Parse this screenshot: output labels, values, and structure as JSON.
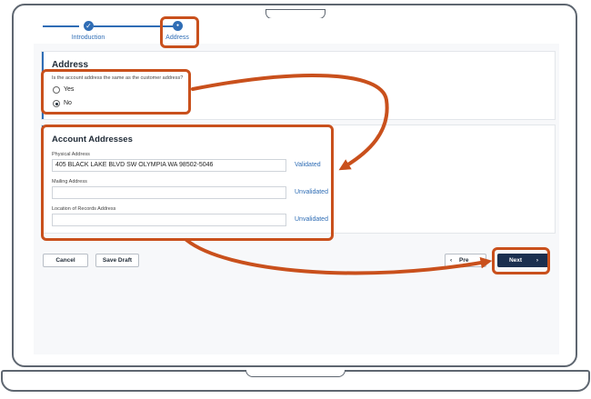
{
  "stepper": {
    "steps": [
      {
        "label": "Introduction",
        "icon": "check-icon",
        "glyph": "✓"
      },
      {
        "label": "Address",
        "icon": "dot-icon",
        "glyph": "●"
      }
    ]
  },
  "address_panel": {
    "title": "Address",
    "question": "Is the account address the same as the customer address?",
    "options": [
      "Yes",
      "No"
    ],
    "selected": "No"
  },
  "account_addresses": {
    "title": "Account Addresses",
    "physical": {
      "label": "Physical Address",
      "value": "405 BLACK LAKE BLVD SW OLYMPIA WA 98502-5046",
      "status": "Validated"
    },
    "mailing": {
      "label": "Mailing Address",
      "value": "",
      "status": "Unvalidated"
    },
    "records": {
      "label": "Location of Records Address",
      "value": "",
      "status": "Unvalidated"
    }
  },
  "footer": {
    "cancel_label": "Cancel",
    "save_draft_label": "Save Draft",
    "previous_label": "Pre",
    "previous_icon_glyph": "‹",
    "next_label": "Next",
    "next_icon_glyph": "›"
  },
  "colors": {
    "accent": "#2f6db5",
    "annotation": "#c9501c",
    "primary_button": "#1b2f4f"
  }
}
